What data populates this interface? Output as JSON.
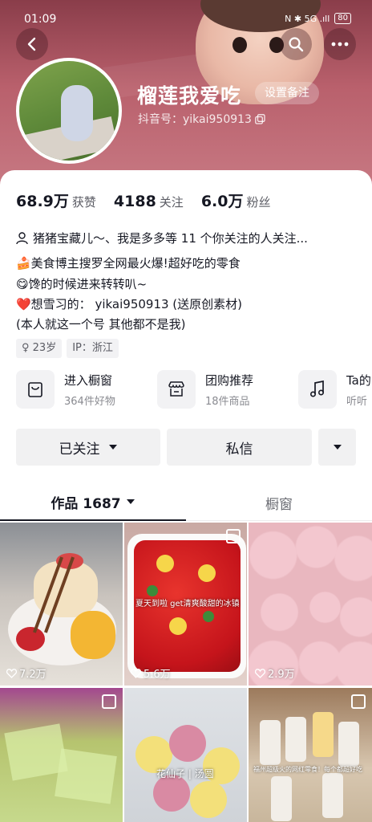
{
  "status_bar": {
    "time": "01:09",
    "indicators": "N ✱ 5G .ıll",
    "battery": "80"
  },
  "header": {
    "back_icon": "chevron-left-icon",
    "search_icon": "search-icon",
    "more_icon": "more-icon",
    "nickname": "榴莲我爱吃",
    "remark_button": "设置备注",
    "douyin_id": "抖音号：yikai950913",
    "copy_icon": "copy-icon"
  },
  "stats": [
    {
      "value": "68.9万",
      "label": "获赞"
    },
    {
      "value": "4188",
      "label": "关注"
    },
    {
      "value": "6.0万",
      "label": "粉丝"
    }
  ],
  "bio": {
    "mutual": "猪猪宝藏儿～、我是多多等 11 个你关注的人关注...",
    "lines": [
      "🍰美食博主搜罗全网最火爆!超好吃的零食",
      "😋馋的时候进来转转叭~",
      "❤️想雪习的： yikai950913 (送原创素材)",
      "(本人就这一个号 其他都不是我)"
    ]
  },
  "tags": {
    "age": "♀ 23岁",
    "ip": "IP：浙江"
  },
  "entries": [
    {
      "icon": "shopping-bag-icon",
      "title": "进入橱窗",
      "subtitle": "364件好物"
    },
    {
      "icon": "store-icon",
      "title": "团购推荐",
      "subtitle": "18件商品"
    },
    {
      "icon": "music-note-icon",
      "title": "Ta的",
      "subtitle": "听听"
    }
  ],
  "actions": {
    "followed": "已关注",
    "message": "私信"
  },
  "tabs": {
    "works": "作品 1687",
    "showcase": "橱窗"
  },
  "videos": [
    {
      "likes": "7.2万",
      "overlay": ""
    },
    {
      "likes": "5.6万",
      "overlay": "夏天到啦 get清爽酸甜的冰镇"
    },
    {
      "likes": "2.9万",
      "overlay": ""
    },
    {
      "likes": "",
      "overlay": ""
    },
    {
      "likes": "",
      "overlay": "花仙子 | 汤圆"
    },
    {
      "likes": "",
      "overlay": "福州超级火的网红零食！每个都超好吃"
    }
  ],
  "colors": {
    "header_bg": "#a24f5e",
    "text": "#161823",
    "muted": "#8a8b91",
    "button_bg": "#f1f1f2"
  }
}
